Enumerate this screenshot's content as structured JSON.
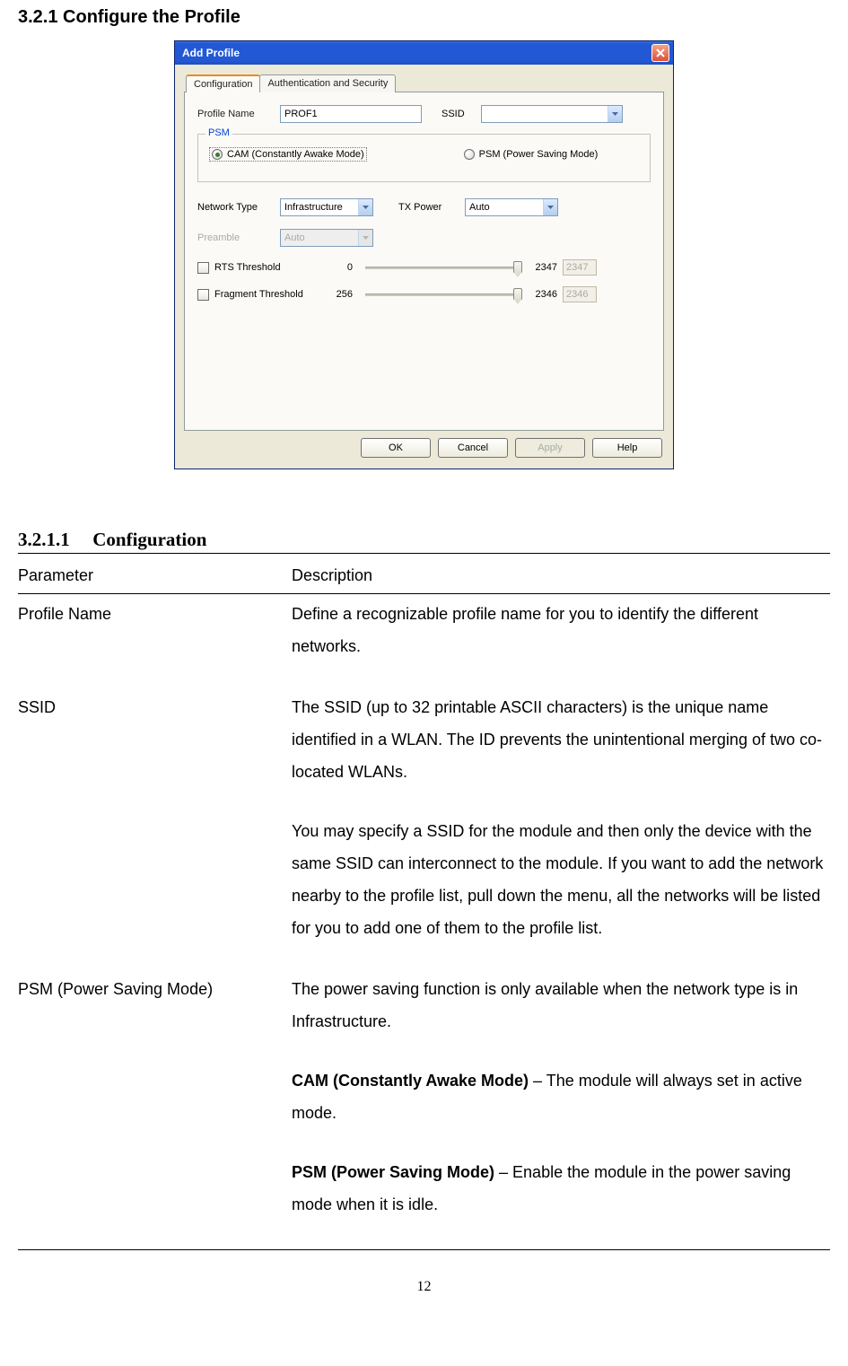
{
  "section_heading": "3.2.1  Configure the Profile",
  "dialog": {
    "title": "Add Profile",
    "tabs": {
      "configuration": "Configuration",
      "auth": "Authentication and Security"
    },
    "labels": {
      "profile_name": "Profile Name",
      "ssid": "SSID",
      "psm_legend": "PSM",
      "cam": "CAM (Constantly Awake Mode)",
      "psm_mode": "PSM (Power Saving Mode)",
      "network_type": "Network Type",
      "tx_power": "TX Power",
      "preamble": "Preamble",
      "rts": "RTS Threshold",
      "frag": "Fragment Threshold"
    },
    "values": {
      "profile_name": "PROF1",
      "ssid": "",
      "network_type": "Infrastructure",
      "tx_power": "Auto",
      "preamble": "Auto",
      "rts_min": "0",
      "rts_max": "2347",
      "rts_val": "2347",
      "frag_min": "256",
      "frag_max": "2346",
      "frag_val": "2346"
    },
    "buttons": {
      "ok": "OK",
      "cancel": "Cancel",
      "apply": "Apply",
      "help": "Help"
    }
  },
  "sub_heading_num": "3.2.1.1",
  "sub_heading_text": "Configuration",
  "table": {
    "head_param": "Parameter",
    "head_desc": "Description",
    "rows": [
      {
        "param": "Profile Name",
        "desc_paras": [
          "Define a recognizable profile name for you to identify the different networks."
        ]
      },
      {
        "param": "SSID",
        "desc_paras": [
          "The SSID (up to 32 printable ASCII characters) is the unique name identified in a WLAN. The ID prevents the unintentional merging of two co-located WLANs.",
          "You may specify a SSID for the module and then only the device with the same SSID can interconnect to the module. If you want to add the network nearby to the profile list, pull down the menu, all the networks will be listed for you to add one of them to the profile list."
        ]
      },
      {
        "param": "PSM (Power Saving Mode)",
        "desc_paras": [
          "The power saving function is only available when the network type is in Infrastructure.",
          "<b>CAM (Constantly Awake Mode)</b> – The module will always set in active mode.",
          "<b>PSM (Power Saving Mode)</b> – Enable the module in the power saving mode when it is idle."
        ]
      }
    ]
  },
  "page_num": "12"
}
